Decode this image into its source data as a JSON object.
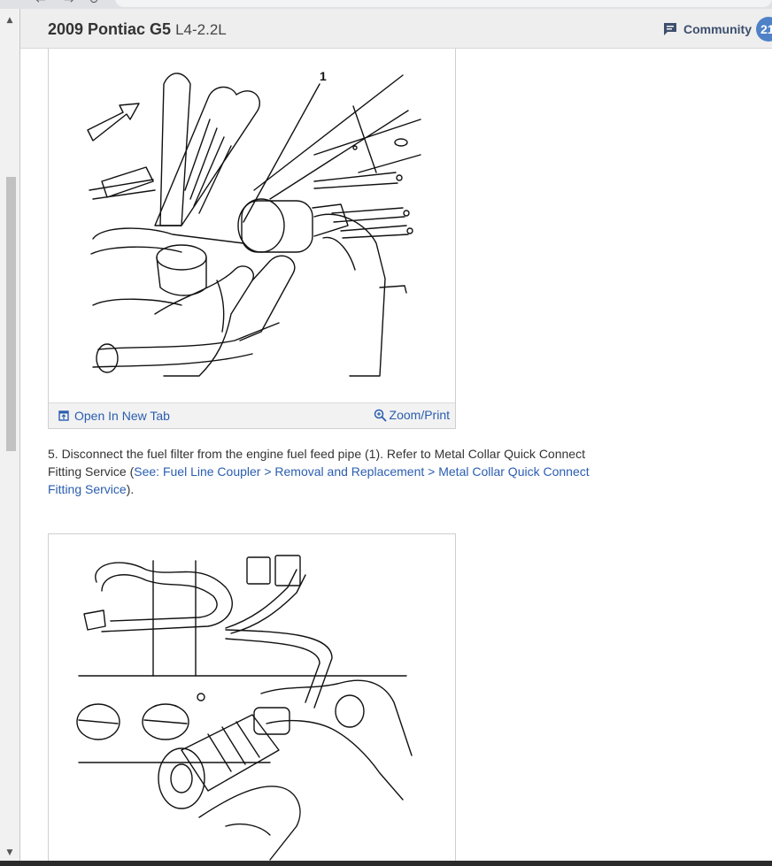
{
  "header": {
    "title": "2009 Pontiac G5",
    "subtitle": "L4-2.2L",
    "community_label": "Community",
    "community_count": "21"
  },
  "figure1": {
    "callout": "1",
    "open_tab_label": "Open In New Tab",
    "zoom_label": "Zoom/Print"
  },
  "step5": {
    "text": " 5. Disconnect the fuel filter from the engine fuel feed pipe (1). Refer to Metal Collar Quick Connect Fitting Service (",
    "link": "See: Fuel Line Coupler > Removal and Replacement > Metal Collar Quick Connect Fitting Service",
    "after": ")."
  },
  "icons": {
    "community": "chat-bubble-icon",
    "open_tab": "open-in-new-tab-icon",
    "zoom": "magnifier-zoom-icon"
  },
  "colors": {
    "link": "#2a5db0",
    "badge": "#4f81c7",
    "header_bg": "#eeeeee"
  }
}
